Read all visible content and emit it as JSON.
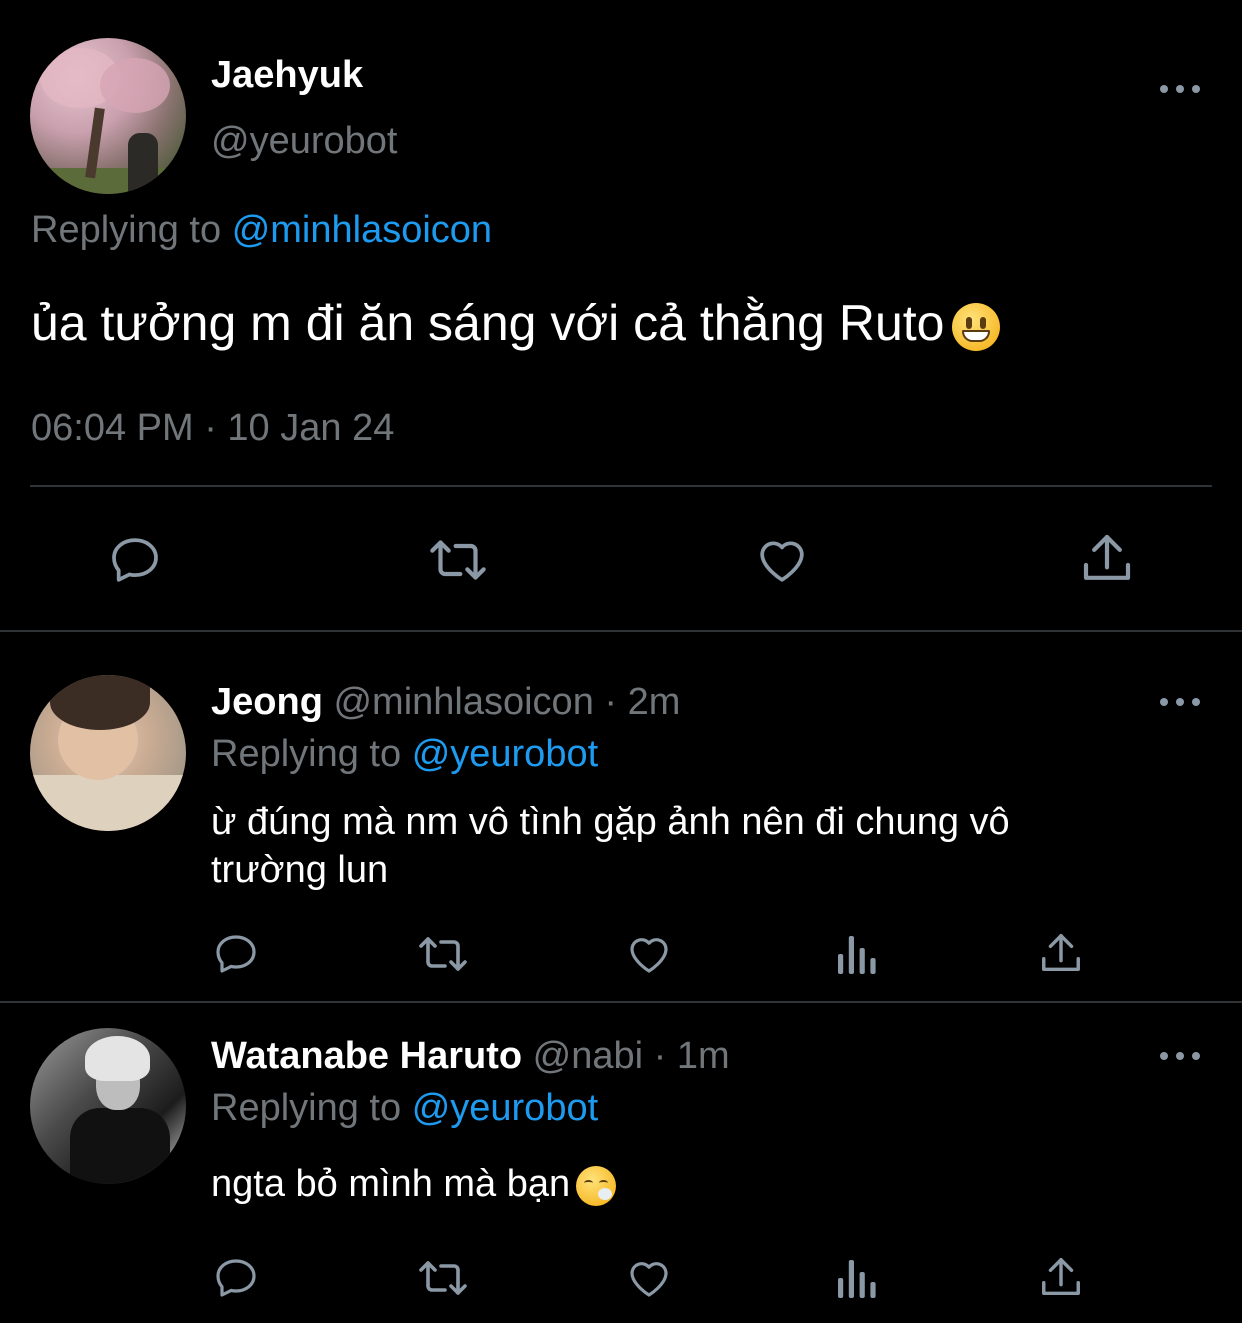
{
  "main_tweet": {
    "name": "Jaehyuk",
    "handle": "@yeurobot",
    "replying_prefix": "Replying to",
    "replying_to": "@minhlasoicon",
    "text": "ủa tưởng m đi ăn sáng với cả thằng Ruto",
    "emoji": "grinning-face-emoji",
    "timestamp": "06:04 PM · 10 Jan 24",
    "actions": [
      "reply-icon",
      "retweet-icon",
      "like-icon",
      "share-icon"
    ]
  },
  "replies": [
    {
      "name": "Jeong",
      "handle": "@minhlasoicon",
      "time": "· 2m",
      "replying_prefix": "Replying to",
      "replying_to": "@yeurobot",
      "text": "ừ đúng mà nm vô tình gặp ảnh nên đi chung vô trường lun",
      "actions": [
        "reply-icon",
        "retweet-icon",
        "like-icon",
        "analytics-icon",
        "share-icon"
      ]
    },
    {
      "name": "Watanabe Haruto",
      "handle": "@nabi",
      "time": "· 1m",
      "replying_prefix": "Replying to",
      "replying_to": "@yeurobot",
      "text": "ngta bỏ mình mà bạn",
      "emoji": "face-exhaling-emoji",
      "actions": [
        "reply-icon",
        "retweet-icon",
        "like-icon",
        "analytics-icon",
        "share-icon"
      ]
    }
  ],
  "colors": {
    "background": "#000000",
    "text_primary": "#ffffff",
    "text_secondary": "#71767b",
    "accent": "#1d9bf0",
    "divider": "#2f3336",
    "icon": "#8b98a5"
  }
}
